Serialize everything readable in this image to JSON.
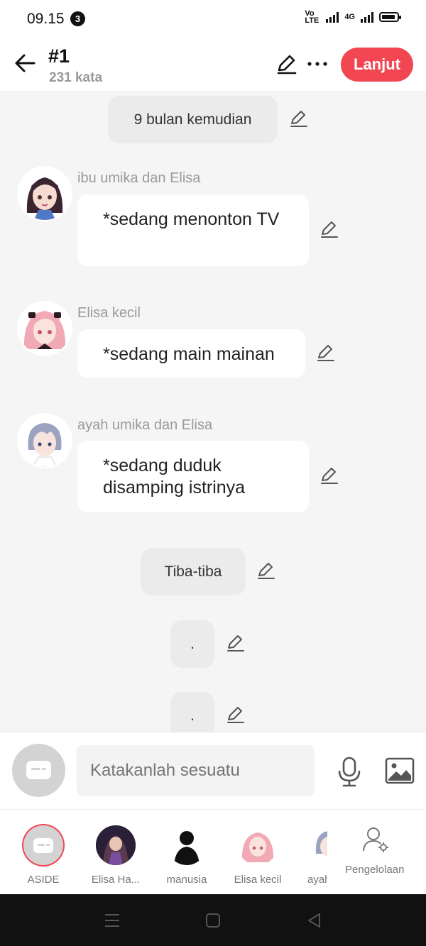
{
  "status": {
    "time": "09.15",
    "notification_count": "3",
    "volte": "Vo LTE",
    "network": "4G"
  },
  "header": {
    "title": "#1",
    "word_count": "231 kata",
    "next_label": "Lanjut"
  },
  "messages": {
    "narration_1": "9 bulan kemudian",
    "speaker_1": "ibu umika dan Elisa",
    "line_1": "*sedang menonton TV",
    "speaker_2": "Elisa kecil",
    "line_2": "*sedang main mainan",
    "speaker_3": "ayah umika dan Elisa",
    "line_3": "*sedang duduk disamping istrinya",
    "narration_2": "Tiba-tiba",
    "narration_3": ".",
    "narration_4": "."
  },
  "composer": {
    "placeholder": "Katakanlah sesuatu"
  },
  "characters": [
    {
      "label": "ASIDE"
    },
    {
      "label": "Elisa Ha..."
    },
    {
      "label": "manusia"
    },
    {
      "label": "Elisa kecil"
    },
    {
      "label": "ayah"
    }
  ],
  "manage_label": "Pengelolaan",
  "colors": {
    "accent": "#f24753",
    "bubble": "#ffffff",
    "narration_bg": "#ebebeb",
    "background": "#f5f5f5"
  }
}
